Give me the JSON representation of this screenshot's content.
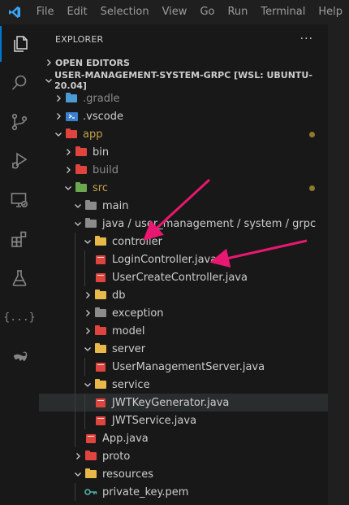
{
  "menu": [
    "File",
    "Edit",
    "Selection",
    "View",
    "Go",
    "Run",
    "Terminal",
    "Help"
  ],
  "explorer": {
    "title": "EXPLORER",
    "more": "···"
  },
  "sections": {
    "open_editors": "OPEN EDITORS",
    "project": "USER-MANAGEMENT-SYSTEM-GRPC [WSL: UBUNTU-20.04]"
  },
  "tree": [
    {
      "label": ".gradle"
    },
    {
      "label": ".vscode"
    },
    {
      "label": "app"
    },
    {
      "label": "bin"
    },
    {
      "label": "build"
    },
    {
      "label": "src"
    },
    {
      "label": "main"
    },
    {
      "label": "java / user_management / system / grpc"
    },
    {
      "label": "controller"
    },
    {
      "label": "LoginController.java"
    },
    {
      "label": "UserCreateController.java"
    },
    {
      "label": "db"
    },
    {
      "label": "exception"
    },
    {
      "label": "model"
    },
    {
      "label": "server"
    },
    {
      "label": "UserManagementServer.java"
    },
    {
      "label": "service"
    },
    {
      "label": "JWTKeyGenerator.java"
    },
    {
      "label": "JWTService.java"
    },
    {
      "label": "App.java"
    },
    {
      "label": "proto"
    },
    {
      "label": "resources"
    },
    {
      "label": "private_key.pem"
    }
  ],
  "colors": {
    "accent": "#0078d4",
    "arrow": "#e8176f",
    "java": "#e0443e",
    "modified": "#c4a24b",
    "untracked": "#73c991"
  }
}
